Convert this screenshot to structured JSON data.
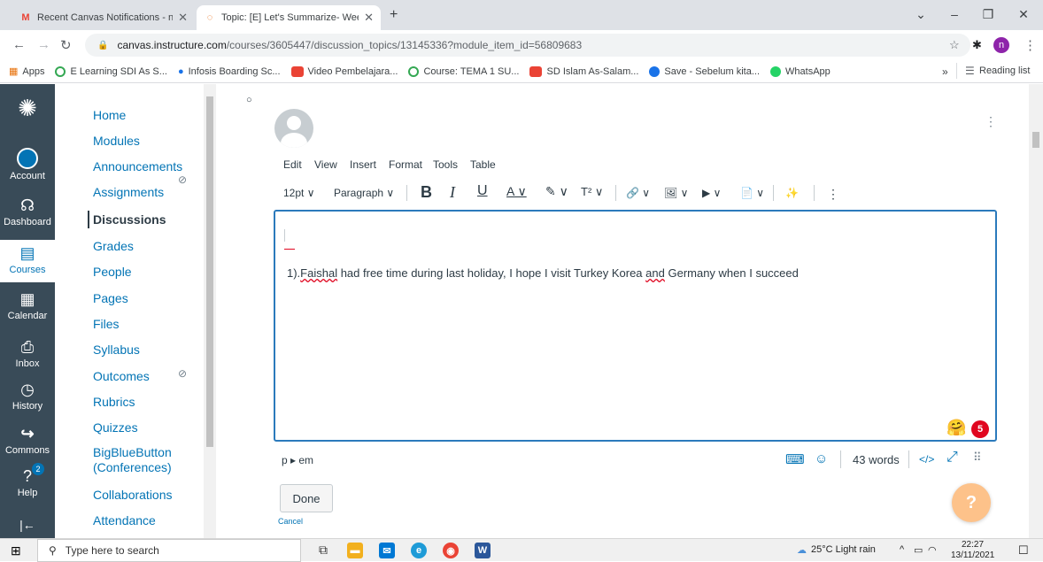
{
  "browser": {
    "tabs": [
      {
        "title": "Recent Canvas Notifications - nal",
        "close": "✕"
      },
      {
        "title": "Topic: [E] Let's Summarize- Week",
        "close": "✕"
      }
    ],
    "new_tab": "+",
    "window_controls": {
      "dropdown": "⌄",
      "minimize": "–",
      "maximize": "❐",
      "close": "✕"
    },
    "url_domain": "canvas.instructure.com",
    "url_path": "/courses/3605447/discussion_topics/13145336?module_item_id=56809683",
    "profile_initial": "n",
    "bookmarks": [
      {
        "label": "Apps",
        "color": "#e8710a"
      },
      {
        "label": "E Learning SDI As S...",
        "color": "#34a853"
      },
      {
        "label": "Infosis Boarding Sc...",
        "color": "#1a73e8"
      },
      {
        "label": "Video Pembelajara...",
        "color": "#ea4335"
      },
      {
        "label": "Course: TEMA 1 SU...",
        "color": "#34a853"
      },
      {
        "label": "SD Islam As-Salam...",
        "color": "#ea4335"
      },
      {
        "label": "Save - Sebelum kita...",
        "color": "#1a73e8"
      },
      {
        "label": "WhatsApp",
        "color": "#25d366"
      }
    ],
    "bookmarks_more": "»",
    "reading_list": "Reading list"
  },
  "global_nav": {
    "items": [
      {
        "label": "Account",
        "icon": "account-avatar"
      },
      {
        "label": "Dashboard",
        "icon": "dashboard-icon"
      },
      {
        "label": "Courses",
        "icon": "courses-icon"
      },
      {
        "label": "Calendar",
        "icon": "calendar-icon"
      },
      {
        "label": "Inbox",
        "icon": "inbox-icon"
      },
      {
        "label": "History",
        "icon": "history-icon"
      },
      {
        "label": "Commons",
        "icon": "commons-icon"
      },
      {
        "label": "Help",
        "icon": "help-icon"
      }
    ],
    "help_badge": "2",
    "collapse": "|←"
  },
  "course_nav": {
    "items": [
      "Home",
      "Modules",
      "Announcements",
      "Assignments",
      "Discussions",
      "Grades",
      "People",
      "Pages",
      "Files",
      "Syllabus",
      "Outcomes",
      "Rubrics",
      "Quizzes",
      "BigBlueButton",
      "(Conferences)",
      "Collaborations",
      "Attendance"
    ],
    "active": "Discussions"
  },
  "editor": {
    "menu": [
      "Edit",
      "View",
      "Insert",
      "Format",
      "Tools",
      "Table"
    ],
    "font_size": "12pt ∨",
    "block_format": "Paragraph ∨",
    "toolbar_symbols": {
      "bold": "B",
      "italic": "I",
      "underline": "U",
      "text_color": "A ∨",
      "highlight": "✎ ∨",
      "superscript": "T² ∨",
      "link": "🔗 ∨",
      "image": "🖼 ∨",
      "media": "▶ ∨",
      "document": "📄 ∨",
      "math": "✨",
      "more": "⋮"
    },
    "text_prefix": "1).",
    "text_misspelled_1": "Faishal",
    "text_mid": " had free time during last holiday, I hope I visit Turkey Korea ",
    "text_misspelled_2": "and",
    "text_end": " Germany when I succeed",
    "path": "p ▸ em",
    "word_count": "43 words",
    "html_toggle": "</>",
    "emoji_badge": "5"
  },
  "buttons": {
    "done": "Done",
    "cancel": "Cancel",
    "help_fab": "?"
  },
  "post_menu": "⋮",
  "taskbar": {
    "search_placeholder": "Type here to search",
    "weather": "25°C  Light rain",
    "time": "22:27",
    "date": "13/11/2021"
  }
}
